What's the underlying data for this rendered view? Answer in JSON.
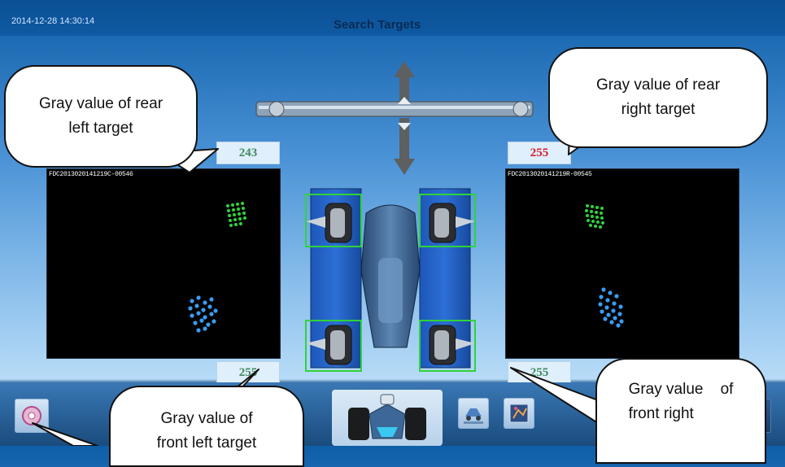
{
  "header": {
    "datetime": "2014-12-28 14:30:14",
    "title": "Search Targets"
  },
  "gray_values": {
    "rear_left": "243",
    "rear_right": "255",
    "front_left": "255",
    "front_right": "255"
  },
  "cameras": {
    "left_label": "FDC2013020141219C-00546",
    "right_label": "FDC2013020141219R-00545"
  },
  "callouts": {
    "rear_left": [
      "Gray value of rear",
      "left target"
    ],
    "rear_right": [
      "Gray value of rear",
      "right target"
    ],
    "front_left": [
      "Gray value of",
      "front left target"
    ],
    "front_right": [
      "Gray value    of",
      "front right"
    ]
  },
  "colors": {
    "value_red": "#d3202c",
    "value_green": "#3f8b5f",
    "target_green": "#2fd33a",
    "target_blue": "#3a9cf0"
  },
  "icons": {
    "disc_button": "disc-icon",
    "vehicle_view": "vehicle-icon",
    "lift_button": "lift-icon",
    "target_button": "target-icon"
  }
}
